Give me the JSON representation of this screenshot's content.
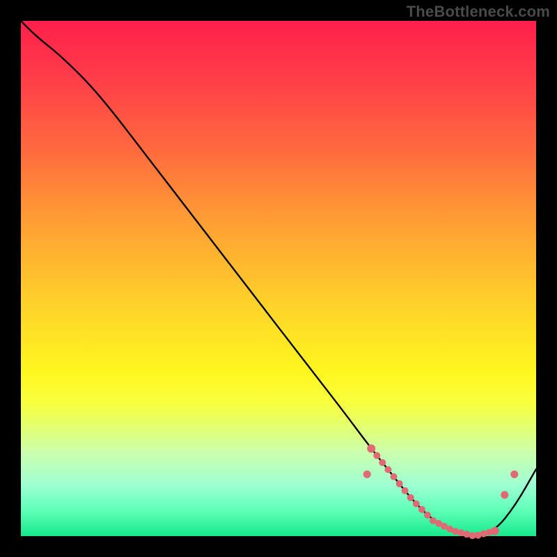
{
  "watermark": "TheBottleneck.com",
  "chart_data": {
    "type": "line",
    "title": "",
    "xlabel": "",
    "ylabel": "",
    "xlim": [
      0,
      100
    ],
    "ylim": [
      0,
      100
    ],
    "series": [
      {
        "name": "curve",
        "x": [
          0,
          3,
          8,
          15,
          25,
          35,
          45,
          55,
          62,
          68,
          72,
          76,
          80,
          84,
          88,
          92,
          96,
          100
        ],
        "y": [
          100,
          97,
          93,
          86,
          73,
          60,
          47,
          34,
          25,
          17,
          12,
          7,
          3,
          1,
          0,
          1,
          6,
          13
        ]
      }
    ],
    "highlight_band": {
      "x_start": 68,
      "x_end": 92,
      "y": 1,
      "color": "#e06a74"
    },
    "colors": {
      "line": "#000000",
      "background_top": "#ff1f4b",
      "background_bottom": "#17e98c",
      "frame": "#000000"
    }
  }
}
